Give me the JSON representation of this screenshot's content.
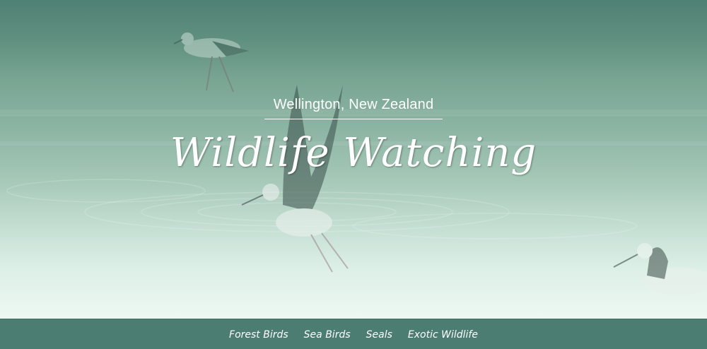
{
  "hero": {
    "subtitle": "Wellington, New Zealand",
    "title": "Wildlife Watching",
    "background_image": "stilt-birds-wading-in-water"
  },
  "nav": {
    "items": [
      {
        "label": "Forest Birds"
      },
      {
        "label": "Sea Birds"
      },
      {
        "label": "Seals"
      },
      {
        "label": "Exotic Wildlife"
      }
    ]
  },
  "colors": {
    "nav_background": "#4c7d72",
    "hero_top": "#4f8174",
    "hero_bottom": "#eef8f3",
    "text": "#ffffff"
  }
}
